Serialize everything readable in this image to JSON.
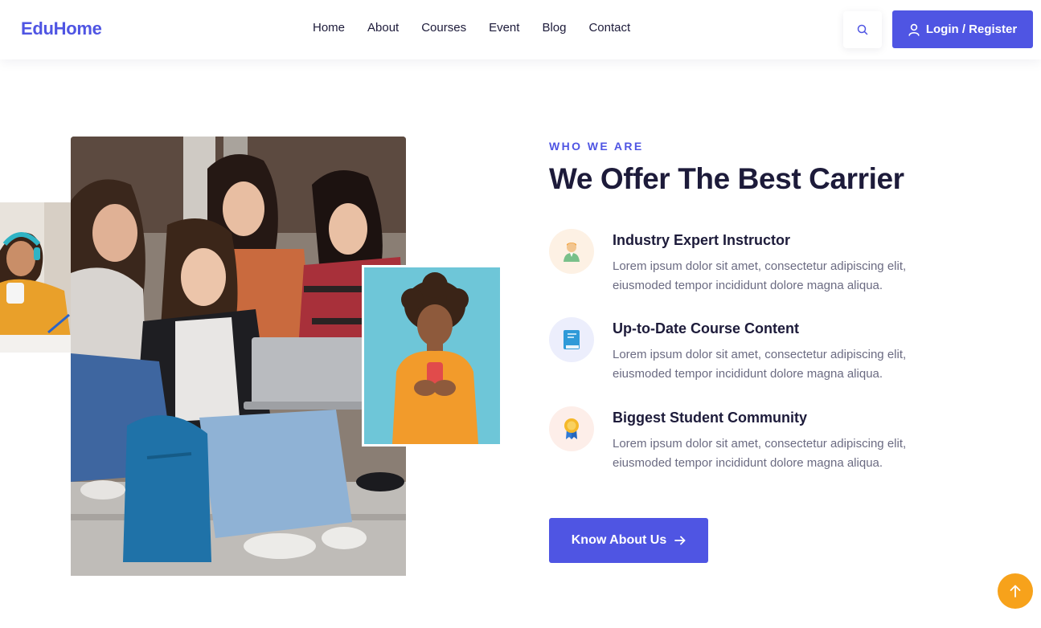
{
  "brand": {
    "logo": "EduHome",
    "accent": "#4f55e3"
  },
  "nav": {
    "items": [
      {
        "label": "Home"
      },
      {
        "label": "About"
      },
      {
        "label": "Courses"
      },
      {
        "label": "Event"
      },
      {
        "label": "Blog"
      },
      {
        "label": "Contact"
      }
    ],
    "search_icon": "search-icon",
    "login_label": "Login / Register",
    "login_icon": "user-icon"
  },
  "images": {
    "left_small": "student-with-headphones-photo",
    "main": "group-of-students-with-laptop-photo",
    "right_small": "woman-using-phone-photo"
  },
  "section": {
    "eyebrow": "WHO WE ARE",
    "title": "We Offer The Best Carrier",
    "features": [
      {
        "icon": "instructor-icon",
        "title": "Industry Expert Instructor",
        "text": "Lorem ipsum dolor sit amet, consectetur adipiscing elit, eiusmoded tempor incididunt dolore magna aliqua."
      },
      {
        "icon": "book-icon",
        "title": "Up-to-Date Course Content",
        "text": "Lorem ipsum dolor sit amet, consectetur adipiscing elit, eiusmoded tempor incididunt dolore magna aliqua."
      },
      {
        "icon": "award-icon",
        "title": "Biggest Student Community",
        "text": "Lorem ipsum dolor sit amet, consectetur adipiscing elit, eiusmoded tempor incididunt dolore magna aliqua."
      }
    ],
    "cta_label": "Know About Us",
    "cta_icon": "arrow-right-icon"
  },
  "scroll_top_icon": "arrow-up-icon",
  "colors": {
    "primary": "#4f55e3",
    "scroll_top": "#f7a21b",
    "heading": "#1d1b3a",
    "body_text": "#6b6b82"
  }
}
